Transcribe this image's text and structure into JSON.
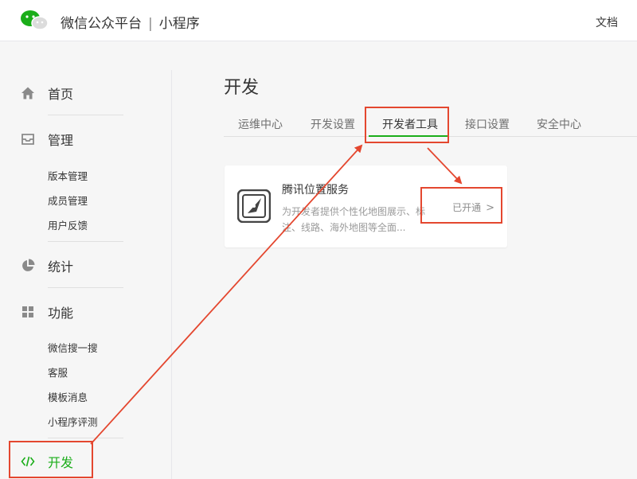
{
  "header": {
    "brand": "微信公众平台",
    "separator": "|",
    "product": "小程序",
    "doc_link": "文档"
  },
  "sidebar": {
    "home": "首页",
    "manage": {
      "label": "管理",
      "items": [
        "版本管理",
        "成员管理",
        "用户反馈"
      ]
    },
    "stats": "统计",
    "features": {
      "label": "功能",
      "items": [
        "微信搜一搜",
        "客服",
        "模板消息",
        "小程序评测"
      ]
    },
    "dev": "开发"
  },
  "main": {
    "title": "开发",
    "tabs": [
      "运维中心",
      "开发设置",
      "开发者工具",
      "接口设置",
      "安全中心"
    ],
    "active_tab": "开发者工具",
    "card": {
      "title": "腾讯位置服务",
      "description": "为开发者提供个性化地图展示、标注、线路、海外地图等全面...",
      "status": "已开通",
      "status_chevron": ">"
    }
  },
  "colors": {
    "accent": "#1aad19",
    "annotation": "#e4472f",
    "background": "#f6f6f6"
  },
  "icons": [
    "wechat-logo-icon",
    "home-icon",
    "inbox-icon",
    "pie-chart-icon",
    "grid-icon",
    "code-icon",
    "compass-map-icon",
    "chevron-right-icon"
  ]
}
